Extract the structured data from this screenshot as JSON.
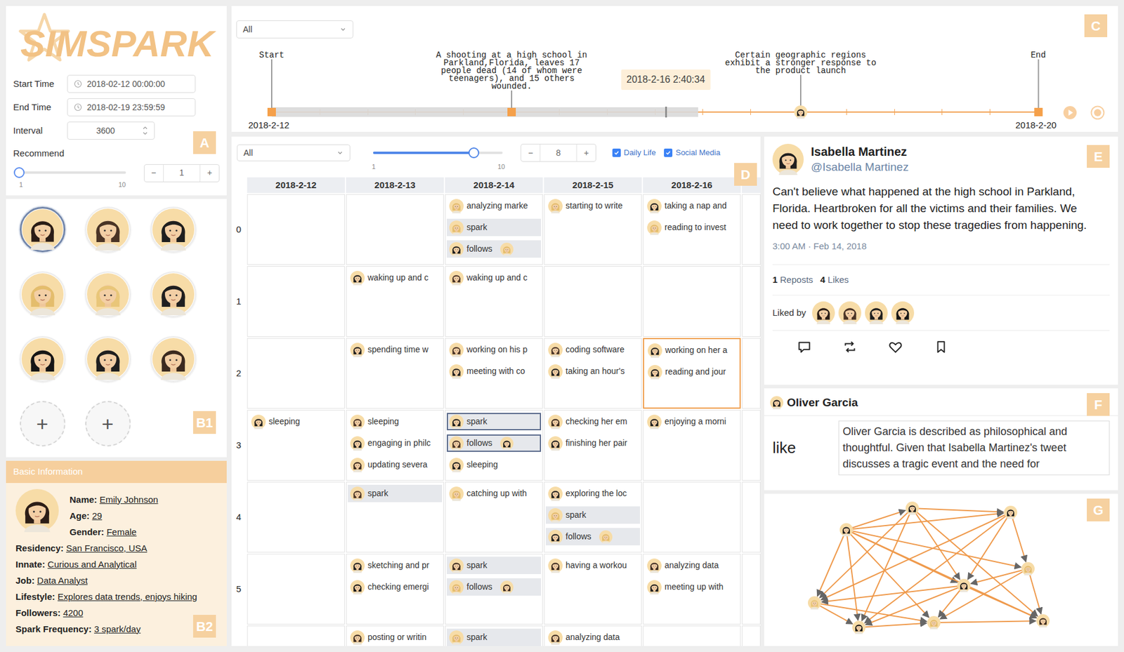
{
  "logo": {
    "text": "SIMSPARK"
  },
  "badges": {
    "a": "A",
    "b1": "B1",
    "b2": "B2",
    "c": "C",
    "d": "D",
    "e": "E",
    "f": "F",
    "g": "G"
  },
  "settings": {
    "start_time": {
      "label": "Start Time",
      "value": "2018-02-12 00:00:00"
    },
    "end_time": {
      "label": "End Time",
      "value": "2018-02-19 23:59:59"
    },
    "interval": {
      "label": "Interval",
      "value": "3600"
    },
    "recommend": {
      "label": "Recommend",
      "level": 0,
      "min": "1",
      "max": "10",
      "value": "1",
      "decrement": "−",
      "increment": "+"
    }
  },
  "agents": [
    {
      "selected": true,
      "color": "#2b1d16"
    },
    {
      "selected": false,
      "color": "#4a3426"
    },
    {
      "selected": false,
      "color": "#1f1f1f"
    },
    {
      "selected": false,
      "color": "#e4bd6c"
    },
    {
      "selected": false,
      "color": "#e9c679"
    },
    {
      "selected": false,
      "color": "#1f1f1f"
    },
    {
      "selected": false,
      "color": "#161616"
    },
    {
      "selected": false,
      "color": "#1f1f1f"
    },
    {
      "selected": false,
      "color": "#3b2a1f"
    }
  ],
  "add_buttons": [
    {
      "label": "+"
    },
    {
      "label": "+"
    }
  ],
  "basic_info": {
    "title": "Basic Information",
    "color": "#2b1d16",
    "fields": [
      {
        "label": "Name:",
        "value": "Emily Johnson"
      },
      {
        "label": "Age:",
        "value": "29"
      },
      {
        "label": "Gender:",
        "value": "Female"
      },
      {
        "label": "Residency:",
        "value": "San Francisco, USA"
      },
      {
        "label": "Innate:",
        "value": "Curious and Analytical"
      },
      {
        "label": "Job:",
        "value": "Data Analyst"
      },
      {
        "label": "Lifestyle:",
        "value": "Explores data trends, enjoys hiking"
      },
      {
        "label": "Followers:",
        "value": "4200"
      },
      {
        "label": "Spark Frequency:",
        "value": "3 spark/day"
      }
    ]
  },
  "timeline": {
    "filter": "All",
    "markers": [
      {
        "kind": "endpoint",
        "label": "Start"
      },
      {
        "kind": "event",
        "label": "A shooting at a high school in\nParkland,Florida, leaves 17\npeople dead (14 of whom were\nteenagers), and 15 others\nwounded."
      },
      {
        "kind": "agent",
        "label": "Certain geographic regions\nexhibit a stronger response to\nthe product launch",
        "color": "#1f1f1f"
      },
      {
        "kind": "endpoint",
        "label": "End"
      }
    ],
    "start_date": "2018-2-12",
    "end_date": "2018-2-20",
    "tooltip": "2018-2-16 2:40:34",
    "level": 0.514,
    "buffer_level": 0.556
  },
  "schedule": {
    "filter": "All",
    "zoom": {
      "level": 0.78,
      "min": "1",
      "max": "10"
    },
    "stepper": {
      "value": "8",
      "decrement": "−",
      "increment": "+"
    },
    "categories": [
      {
        "label": "Daily Life",
        "checked": true
      },
      {
        "label": "Social Media",
        "checked": true
      }
    ],
    "columns": [
      "2018-2-12",
      "2018-2-13",
      "2018-2-14",
      "2018-2-15",
      "2018-2-16"
    ],
    "rows": [
      {
        "label": "0",
        "cells": [
          {
            "selected": false,
            "entries": []
          },
          {
            "selected": false,
            "entries": []
          },
          {
            "selected": false,
            "entries": [
              {
                "kind": "activity",
                "text": "analyzing marke",
                "color": "#e4bd6c",
                "selected": false
              },
              {
                "kind": "spark",
                "text": "spark",
                "color": "#e4bd6c",
                "selected": false
              },
              {
                "kind": "follows",
                "text": "follows",
                "color": "#1f1f1f",
                "target_color": "#e4bd6c",
                "selected": false
              }
            ]
          },
          {
            "selected": false,
            "entries": [
              {
                "kind": "activity",
                "text": "starting to write",
                "color": "#e4bd6c",
                "selected": false
              }
            ]
          },
          {
            "selected": false,
            "entries": [
              {
                "kind": "activity",
                "text": "taking a nap and",
                "color": "#1f1f1f",
                "selected": false
              },
              {
                "kind": "activity",
                "text": "reading to invest",
                "color": "#e4bd6c",
                "selected": false
              }
            ]
          }
        ]
      },
      {
        "label": "1",
        "cells": [
          {
            "selected": false,
            "entries": []
          },
          {
            "selected": false,
            "entries": [
              {
                "kind": "activity",
                "text": "waking up and c",
                "color": "#1f1f1f",
                "selected": false
              }
            ]
          },
          {
            "selected": false,
            "entries": [
              {
                "kind": "activity",
                "text": "waking up and c",
                "color": "#4a3426",
                "selected": false
              }
            ]
          },
          {
            "selected": false,
            "entries": []
          },
          {
            "selected": false,
            "entries": []
          }
        ]
      },
      {
        "label": "2",
        "cells": [
          {
            "selected": false,
            "entries": []
          },
          {
            "selected": false,
            "entries": [
              {
                "kind": "activity",
                "text": "spending time w",
                "color": "#1f1f1f",
                "selected": false
              }
            ]
          },
          {
            "selected": false,
            "entries": [
              {
                "kind": "activity",
                "text": "working on his p",
                "color": "#4a3426",
                "selected": false
              },
              {
                "kind": "activity",
                "text": "meeting with co",
                "color": "#1f1f1f",
                "selected": false
              }
            ]
          },
          {
            "selected": false,
            "entries": [
              {
                "kind": "activity",
                "text": "coding software",
                "color": "#4a3426",
                "selected": false
              },
              {
                "kind": "activity",
                "text": "taking an hour's",
                "color": "#1f1f1f",
                "selected": false
              }
            ]
          },
          {
            "selected": true,
            "entries": [
              {
                "kind": "activity",
                "text": "working on her a",
                "color": "#1f1f1f",
                "selected": false
              },
              {
                "kind": "activity",
                "text": "reading and jour",
                "color": "#1f1f1f",
                "selected": false
              }
            ]
          }
        ]
      },
      {
        "label": "3",
        "cells": [
          {
            "selected": false,
            "entries": [
              {
                "kind": "activity",
                "text": "sleeping",
                "color": "#1f1f1f",
                "selected": false
              }
            ]
          },
          {
            "selected": false,
            "entries": [
              {
                "kind": "activity",
                "text": "sleeping",
                "color": "#4a3426",
                "selected": false
              },
              {
                "kind": "activity",
                "text": "engaging in philc",
                "color": "#1f1f1f",
                "selected": false
              },
              {
                "kind": "activity",
                "text": "updating severa",
                "color": "#3b2a1f",
                "selected": false
              }
            ]
          },
          {
            "selected": false,
            "entries": [
              {
                "kind": "spark",
                "text": "spark",
                "color": "#1f1f1f",
                "selected": true
              },
              {
                "kind": "follows",
                "text": "follows",
                "color": "#4a3426",
                "target_color": "#1f1f1f",
                "selected": true
              },
              {
                "kind": "activity",
                "text": "sleeping",
                "color": "#1f1f1f",
                "selected": false
              }
            ]
          },
          {
            "selected": false,
            "entries": [
              {
                "kind": "activity",
                "text": "checking her em",
                "color": "#3b2a1f",
                "selected": false
              },
              {
                "kind": "activity",
                "text": "finishing her pair",
                "color": "#1f1f1f",
                "selected": false
              }
            ]
          },
          {
            "selected": false,
            "entries": [
              {
                "kind": "activity",
                "text": "enjoying a morni",
                "color": "#1f1f1f",
                "selected": false
              }
            ]
          }
        ]
      },
      {
        "label": "4",
        "cells": [
          {
            "selected": false,
            "entries": []
          },
          {
            "selected": false,
            "entries": [
              {
                "kind": "spark",
                "text": "spark",
                "color": "#4a3426",
                "selected": false
              }
            ]
          },
          {
            "selected": false,
            "entries": [
              {
                "kind": "activity",
                "text": "catching up with",
                "color": "#e4bd6c",
                "selected": false
              }
            ]
          },
          {
            "selected": false,
            "entries": [
              {
                "kind": "activity",
                "text": "exploring the loc",
                "color": "#1f1f1f",
                "selected": false
              },
              {
                "kind": "spark",
                "text": "spark",
                "color": "#e4bd6c",
                "selected": false
              },
              {
                "kind": "follows",
                "text": "follows",
                "color": "#1f1f1f",
                "target_color": "#e4bd6c",
                "selected": false
              }
            ]
          },
          {
            "selected": false,
            "entries": []
          }
        ]
      },
      {
        "label": "5",
        "cells": [
          {
            "selected": false,
            "entries": []
          },
          {
            "selected": false,
            "entries": [
              {
                "kind": "activity",
                "text": "sketching and pr",
                "color": "#1f1f1f",
                "selected": false
              },
              {
                "kind": "activity",
                "text": "checking emergi",
                "color": "#161616",
                "selected": false
              }
            ]
          },
          {
            "selected": false,
            "entries": [
              {
                "kind": "spark",
                "text": "spark",
                "color": "#3b2a1f",
                "selected": false
              },
              {
                "kind": "follows",
                "text": "follows",
                "color": "#e4bd6c",
                "target_color": "#3b2a1f",
                "selected": false
              }
            ]
          },
          {
            "selected": false,
            "entries": [
              {
                "kind": "activity",
                "text": "having a workou",
                "color": "#3b2a1f",
                "selected": false
              }
            ]
          },
          {
            "selected": false,
            "entries": [
              {
                "kind": "activity",
                "text": "analyzing data",
                "color": "#3b2a1f",
                "selected": false
              },
              {
                "kind": "activity",
                "text": "meeting up with",
                "color": "#1f1f1f",
                "selected": false
              }
            ]
          }
        ]
      },
      {
        "label": "",
        "cells": [
          {
            "selected": false,
            "entries": []
          },
          {
            "selected": false,
            "entries": [
              {
                "kind": "activity",
                "text": "posting or writin",
                "color": "#3b2a1f",
                "selected": false
              }
            ]
          },
          {
            "selected": false,
            "entries": [
              {
                "kind": "spark",
                "text": "spark",
                "color": "#e4bd6c",
                "selected": false
              }
            ]
          },
          {
            "selected": false,
            "entries": [
              {
                "kind": "activity",
                "text": "analyzing data",
                "color": "#3b2a1f",
                "selected": false
              }
            ]
          },
          {
            "selected": false,
            "entries": []
          }
        ]
      }
    ]
  },
  "tweet": {
    "author": "Isabella Martinez",
    "handle": "@Isabella Martinez",
    "color": "#1f1f1f",
    "text": "Can't believe what happened at the high school in Parkland, Florida. Heartbroken for all the victims and their families. We need to work together to stop these tragedies from happening.",
    "time": "3:00 AM · Feb 14, 2018",
    "reposts": {
      "count": "1",
      "label": "Reposts"
    },
    "likes": {
      "count": "4",
      "label": "Likes"
    },
    "liked_by_label": "Liked by",
    "liked_by": [
      {
        "color": "#2b1d16"
      },
      {
        "color": "#4a3426"
      },
      {
        "color": "#1f1f1f"
      },
      {
        "color": "#161616"
      }
    ]
  },
  "reaction": {
    "agent": "Oliver Garcia",
    "color": "#1f1f1f",
    "action": "like",
    "reason": "Oliver Garcia is described as philosophical and thoughtful. Given that Isabella Martinez's tweet discusses a tragic event and the need for"
  },
  "network": {
    "nodes": [
      {
        "color": "#1f1f1f"
      },
      {
        "color": "#1f1f1f"
      },
      {
        "color": "#1f1f1f"
      },
      {
        "color": "#e4bd6c"
      },
      {
        "color": "#1f1f1f"
      },
      {
        "color": "#e9c679"
      },
      {
        "color": "#161616"
      },
      {
        "color": "#e4bd6c"
      },
      {
        "color": "#3b2a1f"
      }
    ],
    "edges": [
      [
        0,
        1
      ],
      [
        0,
        2
      ],
      [
        0,
        3
      ],
      [
        0,
        4
      ],
      [
        0,
        5
      ],
      [
        0,
        6
      ],
      [
        0,
        7
      ],
      [
        1,
        2
      ],
      [
        1,
        4
      ],
      [
        1,
        5
      ],
      [
        1,
        6
      ],
      [
        1,
        8
      ],
      [
        2,
        3
      ],
      [
        2,
        4
      ],
      [
        2,
        5
      ],
      [
        2,
        6
      ],
      [
        3,
        4
      ],
      [
        3,
        7
      ],
      [
        3,
        8
      ],
      [
        4,
        5
      ],
      [
        4,
        6
      ],
      [
        4,
        7
      ],
      [
        4,
        8
      ],
      [
        5,
        6
      ],
      [
        5,
        7
      ],
      [
        6,
        7
      ],
      [
        7,
        8
      ],
      [
        0,
        8
      ]
    ]
  }
}
